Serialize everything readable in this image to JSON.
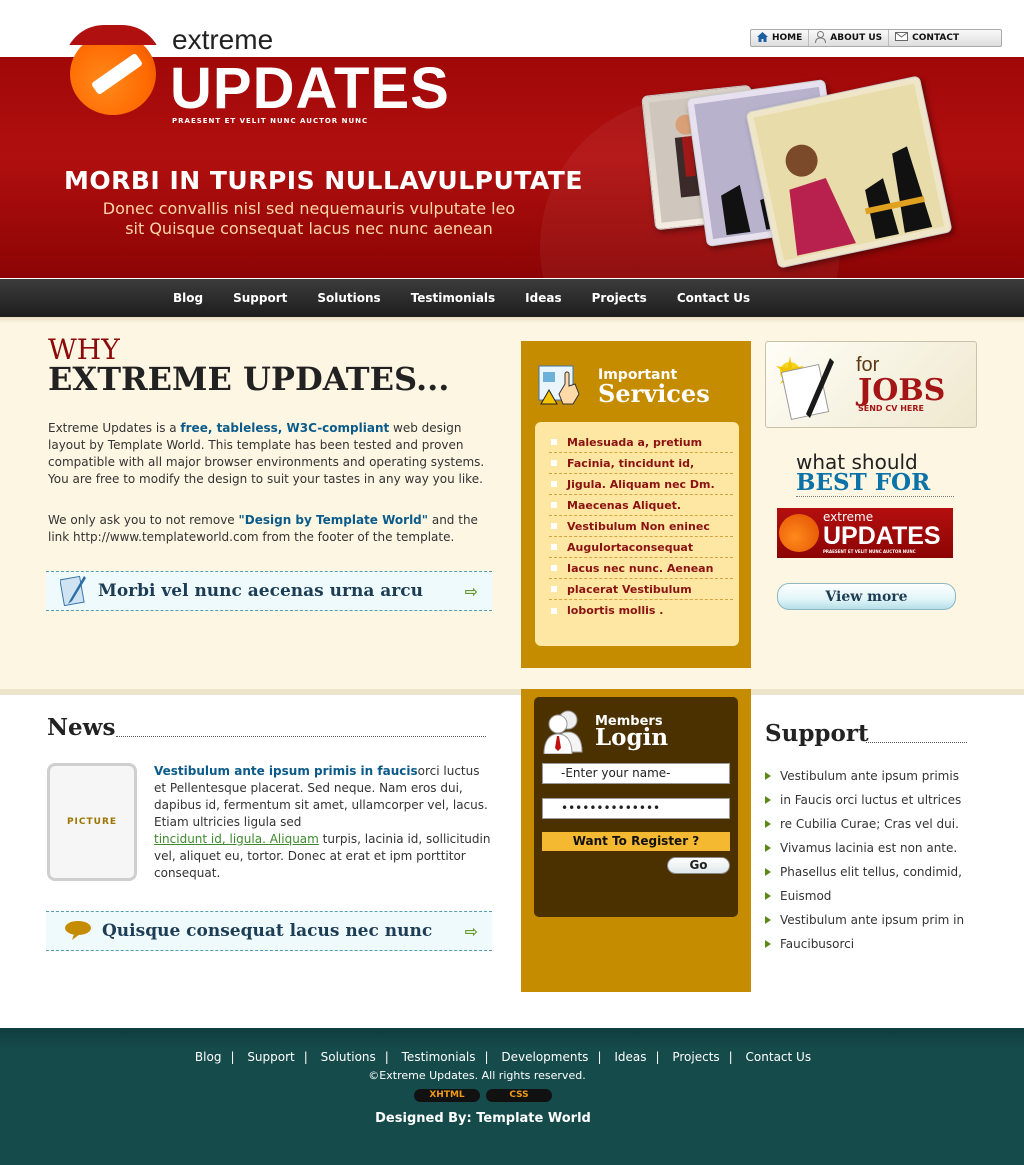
{
  "topnav": {
    "home": "HOME",
    "about": "ABOUT US",
    "contact": "CONTACT"
  },
  "brand": {
    "extreme": "extreme",
    "updates": "UPDATES",
    "tagline": "PRAESENT ET VELIT NUNC AUCTOR NUNC"
  },
  "hero": {
    "headline": "MORBI IN TURPIS NULLAVULPUTATE",
    "sub_line1": "Donec convallis nisl sed nequemauris vulputate leo",
    "sub_line2": "sit Quisque consequat lacus nec nunc aenean"
  },
  "mainnav": [
    "Blog",
    "Support",
    "Solutions",
    "Testimonials",
    "Ideas",
    "Projects",
    "Contact Us"
  ],
  "why": {
    "small": "WHY",
    "big": "EXTREME UPDATES...",
    "p1_pre": "Extreme Updates is a ",
    "p1_bold": "free, tableless, W3C-compliant",
    "p1_post": " web design layout by Template World. This template has been tested and proven compatible with all major browser environments and operating systems. You are free to modify the design to suit your tastes in any way you like.",
    "p2_pre": "We only ask you to not remove ",
    "p2_bold": "\"Design by Template World\"",
    "p2_post": " and the link http://www.templateworld.com from the footer of the template."
  },
  "bar1": "Morbi vel nunc aecenas urna arcu",
  "services": {
    "title_small": "Important",
    "title_big": "Services",
    "items": [
      "Malesuada a, pretium",
      "Facinia, tincidunt id,",
      "Jigula. Aliquam nec Dm.",
      "Maecenas Aliquet.",
      "Vestibulum Non eninec",
      "AuguIortaconsequat",
      "Iacus nec nunc. Aenean",
      "placerat Vestibulum",
      "lobortis mollis ."
    ]
  },
  "jobs": {
    "for": "for",
    "jobs": "JOBS",
    "send": "SEND CV HERE"
  },
  "best": {
    "what": "what should",
    "best": "BEST FOR"
  },
  "minilogo": {
    "extreme": "extreme",
    "updates": "UPDATES",
    "tagline": "PRAESENT ET VELIT NUNC AUCTOR NUNC"
  },
  "viewmore": "View more",
  "news": {
    "heading": "News",
    "picture": "PICTURE",
    "lead": "Vestibulum ante ipsum primis in faucis",
    "text1": "orci luctus et Pellentesque placerat. Sed neque. Nam eros dui, dapibus id, fermentum sit amet, ullamcorper vel, lacus. Etiam ultricies ligula sed",
    "link": "tincidunt id, ligula. Aliquam",
    "text2": " turpis, lacinia id, sollicitudin vel, aliquet eu, tortor. Donec at erat et ipm porttitor consequat."
  },
  "bar2": "Quisque consequat lacus nec nunc",
  "login": {
    "title_small": "Members",
    "title_big": "Login",
    "name_value": "-Enter your name-",
    "password_value": "••••••••••••••",
    "register": "Want To Register ?",
    "go": "Go"
  },
  "support": {
    "heading": "Support",
    "items": [
      "Vestibulum ante ipsum primis",
      "in Faucis orci luctus et ultrices",
      "re Cubilia Curae; Cras vel dui.",
      "Vivamus lacinia est non ante.",
      "Phasellus elit tellus, condimid,",
      "Euismod",
      "Vestibulum ante ipsum prim in",
      "Faucibusorci"
    ]
  },
  "footer": {
    "links": [
      "Blog",
      "Support",
      "Solutions",
      "Testimonials",
      "Developments",
      "Ideas",
      "Projects",
      "Contact Us"
    ],
    "separator": "|",
    "copyright": "©Extreme Updates. All rights reserved.",
    "badge_xhtml": "XHTML",
    "badge_css": "CSS",
    "designed": "Designed By:  Template World"
  },
  "colors": {
    "header_red": "#a00808",
    "nav_dark": "#2a2a2a",
    "cream": "#fdf6e3",
    "gold": "#c68c00",
    "footer_teal": "#164b4b",
    "link_blue": "#0b5b8a"
  }
}
